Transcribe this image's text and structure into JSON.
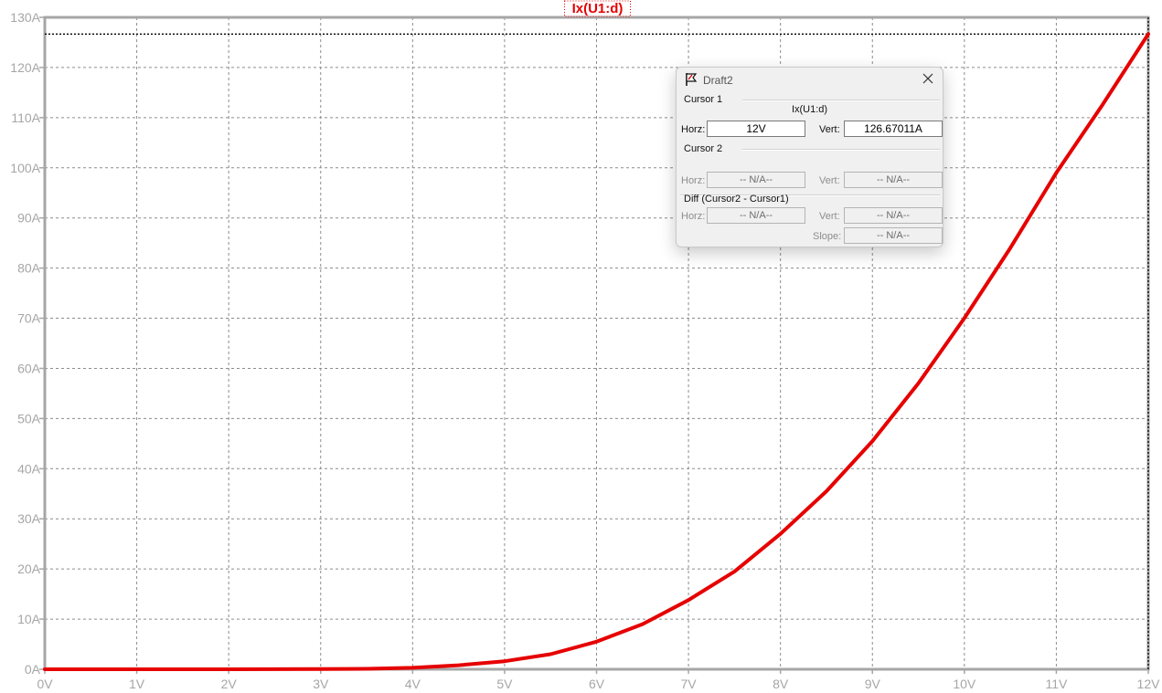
{
  "chart_data": {
    "type": "line",
    "title": "Ix(U1:d)",
    "xlabel": "",
    "ylabel": "",
    "xlim": [
      0,
      12
    ],
    "ylim": [
      0,
      130
    ],
    "x_ticks": [
      0,
      1,
      2,
      3,
      4,
      5,
      6,
      7,
      8,
      9,
      10,
      11,
      12
    ],
    "x_tick_labels": [
      "0V",
      "1V",
      "2V",
      "3V",
      "4V",
      "5V",
      "6V",
      "7V",
      "8V",
      "9V",
      "10V",
      "11V",
      "12V"
    ],
    "y_ticks": [
      0,
      10,
      20,
      30,
      40,
      50,
      60,
      70,
      80,
      90,
      100,
      110,
      120,
      130
    ],
    "y_tick_labels": [
      "0A",
      "10A",
      "20A",
      "30A",
      "40A",
      "50A",
      "60A",
      "70A",
      "80A",
      "90A",
      "100A",
      "110A",
      "120A",
      "130A"
    ],
    "grid": true,
    "series": [
      {
        "name": "Ix(U1:d)",
        "color": "#e60000",
        "x": [
          0,
          1,
          2,
          3,
          3.5,
          4,
          4.5,
          5,
          5.5,
          6,
          6.5,
          7,
          7.5,
          8,
          8.5,
          9,
          9.5,
          10,
          10.5,
          11,
          11.5,
          12
        ],
        "y": [
          0,
          0,
          0,
          0.05,
          0.1,
          0.3,
          0.8,
          1.6,
          3.0,
          5.5,
          9.0,
          13.8,
          19.5,
          27.0,
          35.5,
          45.5,
          57.0,
          70.0,
          84.0,
          99.0,
          112.5,
          126.67
        ]
      }
    ],
    "cursor": {
      "x": 12,
      "y": 126.67011,
      "color": "#000000"
    }
  },
  "dialog": {
    "title": "Draft2",
    "cursor1_label": "Cursor 1",
    "trace_name": "Ix(U1:d)",
    "horz_label": "Horz:",
    "vert_label": "Vert:",
    "cursor1_horz": "12V",
    "cursor1_vert": "126.67011A",
    "cursor2_label": "Cursor 2",
    "cursor2_horz": "-- N/A--",
    "cursor2_vert": "-- N/A--",
    "diff_label": "Diff (Cursor2 - Cursor1)",
    "diff_horz": "-- N/A--",
    "diff_vert": "-- N/A--",
    "slope_label": "Slope:",
    "diff_slope": "-- N/A--",
    "icon": "cursor-flag-icon",
    "close_icon": "close-icon"
  }
}
